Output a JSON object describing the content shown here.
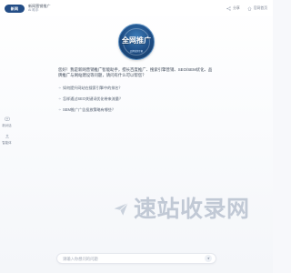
{
  "header": {
    "logo_text": "新网",
    "title": "新网营销推广",
    "subtitle": "AI 助手",
    "actions": [
      {
        "label": "分享",
        "icon": "share-icon"
      },
      {
        "label": "官网首页",
        "icon": "home-icon"
      }
    ]
  },
  "hero": {
    "badge_text": "全网推广",
    "badge_slogan": "品牌营销专家"
  },
  "sidebar": {
    "items": [
      {
        "label": "新对话",
        "icon": "new-chat-icon"
      },
      {
        "label": "智能体",
        "icon": "agent-icon"
      }
    ]
  },
  "main": {
    "intro": "您好！我是新网营销推广智能助手，擅长百度推广、搜索引擎营销、SEO/SEM优化、品牌推广与网站建设等问题，请问有什么可以帮您？",
    "questions": [
      {
        "label": "如何提升网站在搜索引擎中的排名？",
        "icon": "arrow-right-icon"
      },
      {
        "label": "怎样通过SEO关键词优化带来流量？",
        "icon": "arrow-right-icon"
      },
      {
        "label": "SEM推广广告投放策略有哪些？",
        "icon": "arrow-right-icon"
      }
    ]
  },
  "watermark": {
    "text": "速站收录网",
    "icon": "paper-plane-icon"
  },
  "composer": {
    "placeholder": "请输入你想问的问题",
    "send_icon": "send-icon"
  },
  "colors": {
    "brand": "#234d86",
    "accent": "#5a8fc2",
    "watermark": "#bfc7d4"
  }
}
